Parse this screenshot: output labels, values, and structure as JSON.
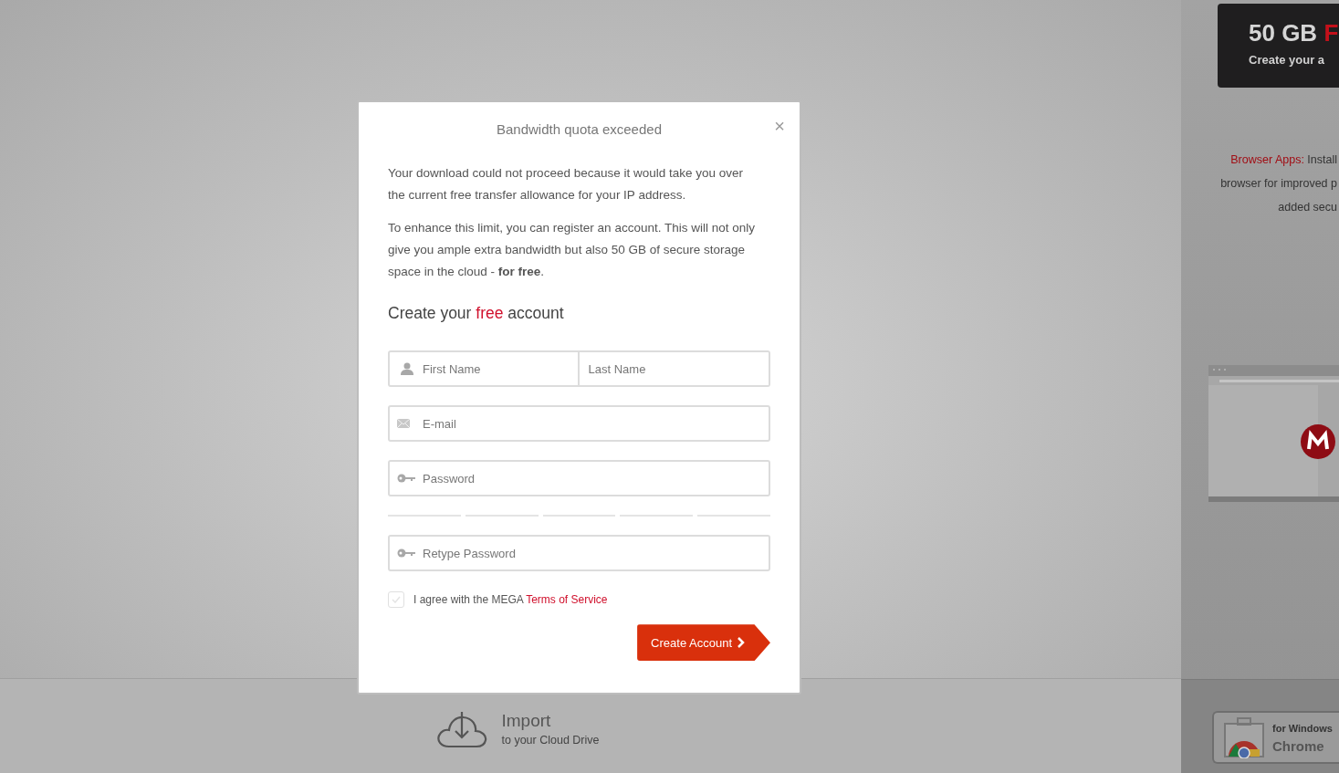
{
  "promo_card": {
    "size": "50 GB",
    "accent": "F",
    "subtitle": "Create your a"
  },
  "browser_apps": {
    "label": "Browser Apps:",
    "lines": [
      "Install",
      "browser for improved p",
      "added secu"
    ]
  },
  "chrome_badge": {
    "platform": "for Windows",
    "name": "Chrome"
  },
  "import": {
    "title": "Import",
    "subtitle": "to your Cloud Drive"
  },
  "dialog": {
    "title": "Bandwidth quota exceeded",
    "close": "×",
    "paragraphs": [
      "Your download could not proceed because it would take you over the current free transfer allowance for your IP address.",
      "To enhance this limit, you can register an account. This will not only give you ample extra bandwidth but also 50 GB of secure storage space in the cloud - **for free**."
    ],
    "heading": {
      "before": "Create your",
      "accent": "free",
      "after": "account"
    },
    "name_fields": [
      {
        "kind": "user",
        "placeholder": "First Name"
      },
      {
        "kind": "plain",
        "placeholder": "Last Name"
      }
    ],
    "fields": [
      {
        "kind": "mail",
        "placeholder": "E-mail"
      },
      {
        "kind": "key",
        "placeholder": "Password"
      },
      {
        "kind": "meter"
      },
      {
        "kind": "key",
        "placeholder": "Retype Password"
      }
    ],
    "agree": {
      "checked": false,
      "text": "I agree with the MEGA",
      "link": "Terms of Service"
    },
    "submit": "Create Account"
  }
}
